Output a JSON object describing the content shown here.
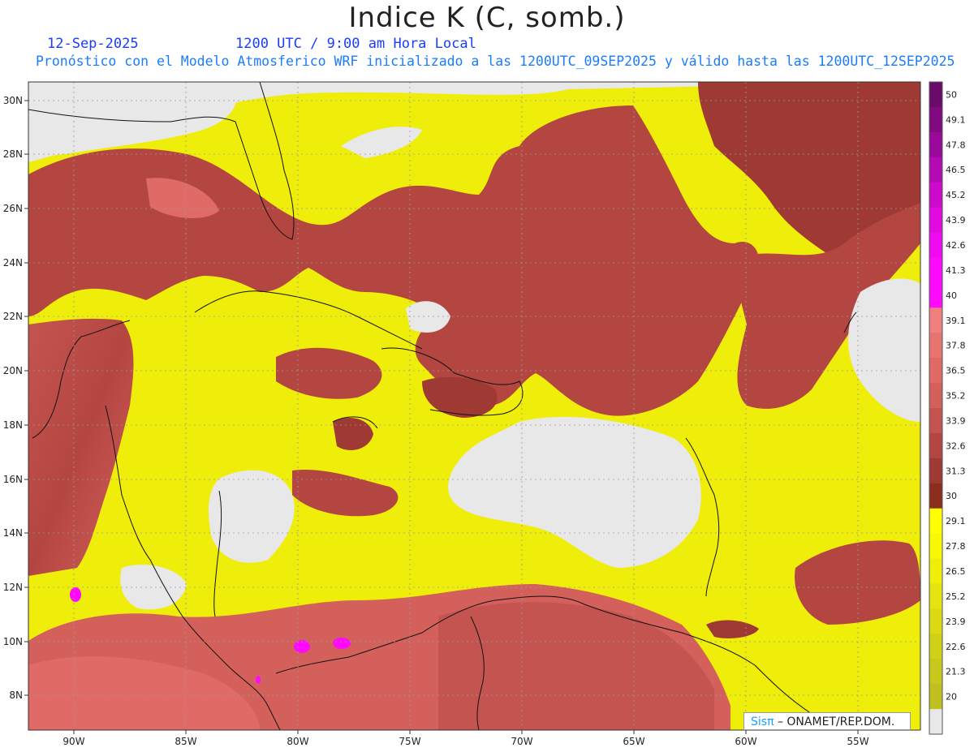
{
  "header": {
    "title": "Indice K (C, somb.)",
    "date": "12-Sep-2025",
    "time": "1200 UTC / 9:00 am Hora Local",
    "description": "Pronóstico con el Modelo Atmosferico WRF inicializado a las 1200UTC_09SEP2025 y válido hasta las  1200UTC_12SEP2025"
  },
  "map": {
    "lon_range": [
      -92,
      -50
    ],
    "lat_range": [
      7,
      31
    ],
    "lon_ticks": [
      "90W",
      "85W",
      "80W",
      "75W",
      "70W",
      "65W",
      "60W",
      "55W"
    ],
    "lat_ticks": [
      "8N",
      "10N",
      "12N",
      "14N",
      "16N",
      "18N",
      "20N",
      "22N",
      "24N",
      "26N",
      "28N",
      "30N"
    ],
    "colors": {
      "land_nodata": "#e8e8e8",
      "coast": "#111111",
      "grid": "#9a9a9a"
    }
  },
  "colorbar": {
    "labels": [
      "50",
      "49.1",
      "47.8",
      "46.5",
      "45.2",
      "43.9",
      "42.6",
      "41.3",
      "40",
      "39.1",
      "37.8",
      "36.5",
      "35.2",
      "33.9",
      "32.6",
      "31.3",
      "30",
      "29.1",
      "27.8",
      "26.5",
      "25.2",
      "23.9",
      "22.6",
      "21.3",
      "20"
    ],
    "colors": [
      "#6a0a6a",
      "#800a80",
      "#9a0a9a",
      "#b40ab4",
      "#cc0acc",
      "#e10ae1",
      "#f00af0",
      "#ff0aff",
      "#ff0aff",
      "#f08080",
      "#e87470",
      "#e06b66",
      "#d4605b",
      "#c45450",
      "#b44642",
      "#9e3a33",
      "#8a2e1e",
      "#ffff00",
      "#f8f804",
      "#eeee0a",
      "#e4e410",
      "#dada14",
      "#d0d018",
      "#c8c81c",
      "#c0c020",
      "#e8e8e8"
    ]
  },
  "credit": {
    "brand": "Sis",
    "pi": "π",
    "text": " – ONAMET/REP.DOM."
  }
}
